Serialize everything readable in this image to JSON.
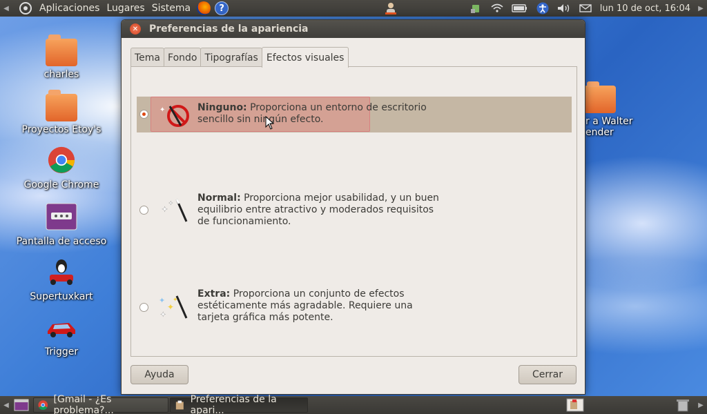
{
  "top_panel": {
    "menus": [
      "Aplicaciones",
      "Lugares",
      "Sistema"
    ],
    "clock": "lun 10 de oct, 16:04"
  },
  "desktop_icons": [
    {
      "label": "charles",
      "icon": "folder-icon"
    },
    {
      "label": "Proyectos Etoy's",
      "icon": "folder-icon"
    },
    {
      "label": "Google Chrome",
      "icon": "chrome-icon"
    },
    {
      "label": "Pantalla de acceso",
      "icon": "login-screen-icon"
    },
    {
      "label": "Supertuxkart",
      "icon": "tux-kart-icon"
    },
    {
      "label": "Trigger",
      "icon": "car-icon"
    }
  ],
  "desktop_right_icon": {
    "label_line1": "r  a Walter",
    "label_line2": "ender"
  },
  "dialog": {
    "title": "Preferencias de la apariencia",
    "tabs": [
      "Tema",
      "Fondo",
      "Tipografías",
      "Efectos visuales"
    ],
    "active_tab": "Efectos visuales",
    "options": [
      {
        "title": "Ninguno:",
        "desc": "Proporciona un entorno de escritorio sencillo sin ningún efecto.",
        "selected": true
      },
      {
        "title": "Normal:",
        "desc": "Proporciona mejor usabilidad, y un buen equilibrio entre atractivo y moderados requisitos de funcionamiento.",
        "selected": false
      },
      {
        "title": "Extra:",
        "desc": "Proporciona un conjunto de efectos estéticamente más agradable. Requiere una tarjeta gráfica más potente.",
        "selected": false
      }
    ],
    "help_button": "Ayuda",
    "close_button": "Cerrar"
  },
  "taskbar": {
    "tasks": [
      {
        "label": "[Gmail - ¿Es problema?...",
        "active": false
      },
      {
        "label": "Preferencias de la apari...",
        "active": true
      }
    ]
  },
  "colors": {
    "accent": "#dd4814",
    "selection": "#c5b7a4",
    "panel": "#3c3b37"
  }
}
